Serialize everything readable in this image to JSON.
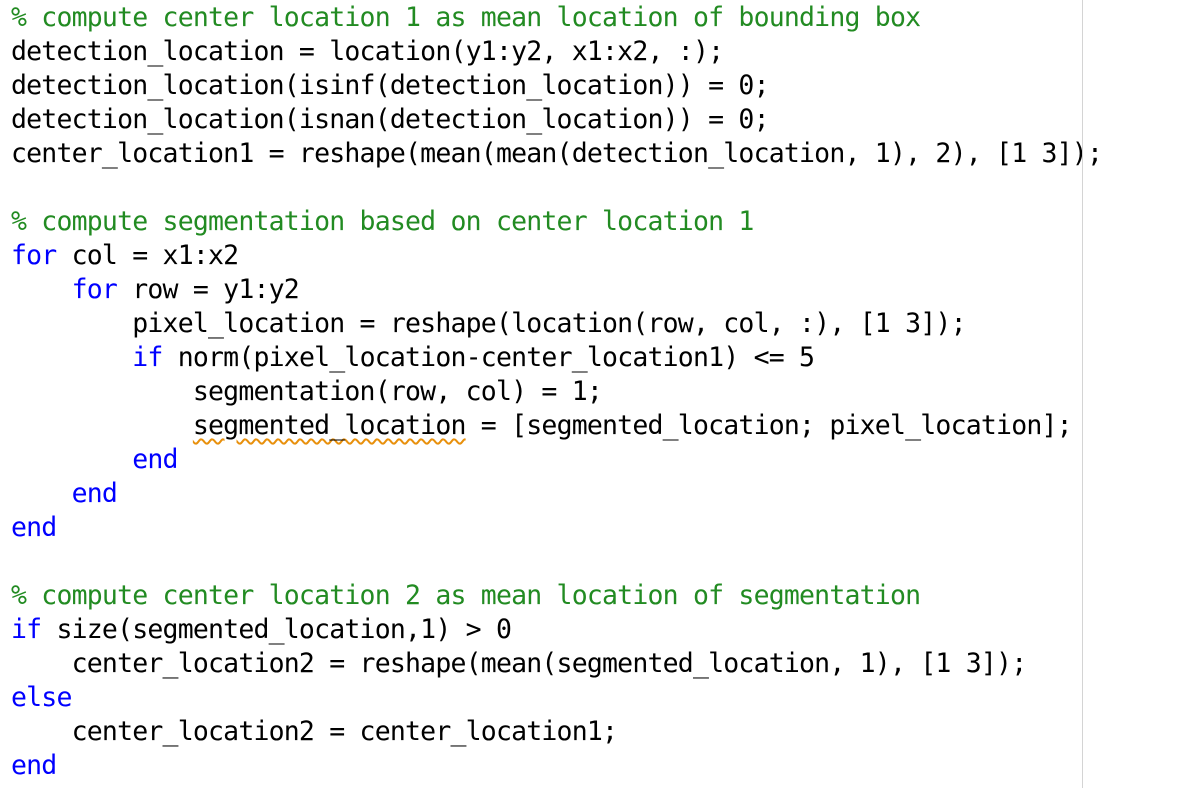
{
  "editor": {
    "lines": [
      {
        "segments": [
          {
            "t": "comment",
            "text": "% compute center location 1 as mean location of bounding box"
          }
        ]
      },
      {
        "segments": [
          {
            "t": "code",
            "text": "detection_location = location(y1:y2, x1:x2, :);"
          }
        ]
      },
      {
        "segments": [
          {
            "t": "code",
            "text": "detection_location(isinf(detection_location)) = 0;"
          }
        ]
      },
      {
        "segments": [
          {
            "t": "code",
            "text": "detection_location(isnan(detection_location)) = 0;"
          }
        ]
      },
      {
        "segments": [
          {
            "t": "code",
            "text": "center_location1 = reshape(mean(mean(detection_location, 1), 2), [1 3]);"
          }
        ]
      },
      {
        "segments": []
      },
      {
        "segments": [
          {
            "t": "comment",
            "text": "% compute segmentation based on center location 1"
          }
        ]
      },
      {
        "segments": [
          {
            "t": "keyword",
            "text": "for"
          },
          {
            "t": "code",
            "text": " col = x1:x2"
          }
        ]
      },
      {
        "segments": [
          {
            "t": "code",
            "text": "    "
          },
          {
            "t": "keyword",
            "text": "for"
          },
          {
            "t": "code",
            "text": " row = y1:y2"
          }
        ]
      },
      {
        "segments": [
          {
            "t": "code",
            "text": "        pixel_location = reshape(location(row, col, :), [1 3]);"
          }
        ]
      },
      {
        "segments": [
          {
            "t": "code",
            "text": "        "
          },
          {
            "t": "keyword",
            "text": "if"
          },
          {
            "t": "code",
            "text": " norm(pixel_location-center_location1) <= 5"
          }
        ]
      },
      {
        "segments": [
          {
            "t": "code",
            "text": "            segmentation(row, col) = 1;"
          }
        ]
      },
      {
        "segments": [
          {
            "t": "code",
            "text": "            "
          },
          {
            "t": "squiggle",
            "text": "segmented_location"
          },
          {
            "t": "code",
            "text": " = [segmented_location; pixel_location];"
          }
        ]
      },
      {
        "segments": [
          {
            "t": "code",
            "text": "        "
          },
          {
            "t": "keyword",
            "text": "end"
          }
        ]
      },
      {
        "segments": [
          {
            "t": "code",
            "text": "    "
          },
          {
            "t": "keyword",
            "text": "end"
          }
        ]
      },
      {
        "segments": [
          {
            "t": "keyword",
            "text": "end"
          }
        ]
      },
      {
        "segments": []
      },
      {
        "segments": [
          {
            "t": "comment",
            "text": "% compute center location 2 as mean location of segmentation"
          }
        ]
      },
      {
        "segments": [
          {
            "t": "keyword",
            "text": "if"
          },
          {
            "t": "code",
            "text": " size(segmented_location,1) > 0"
          }
        ]
      },
      {
        "segments": [
          {
            "t": "code",
            "text": "    center_location2 = reshape(mean(segmented_location, 1), [1 3]);"
          }
        ]
      },
      {
        "segments": [
          {
            "t": "keyword",
            "text": "else"
          }
        ]
      },
      {
        "segments": [
          {
            "t": "code",
            "text": "    center_location2 = center_location1;"
          }
        ]
      },
      {
        "segments": [
          {
            "t": "keyword",
            "text": "end"
          }
        ]
      }
    ]
  },
  "colors": {
    "comment": "#228B22",
    "keyword": "#0000FF",
    "code": "#000000",
    "warning_squiggle": "#E8900C",
    "background": "#FFFFFF"
  }
}
